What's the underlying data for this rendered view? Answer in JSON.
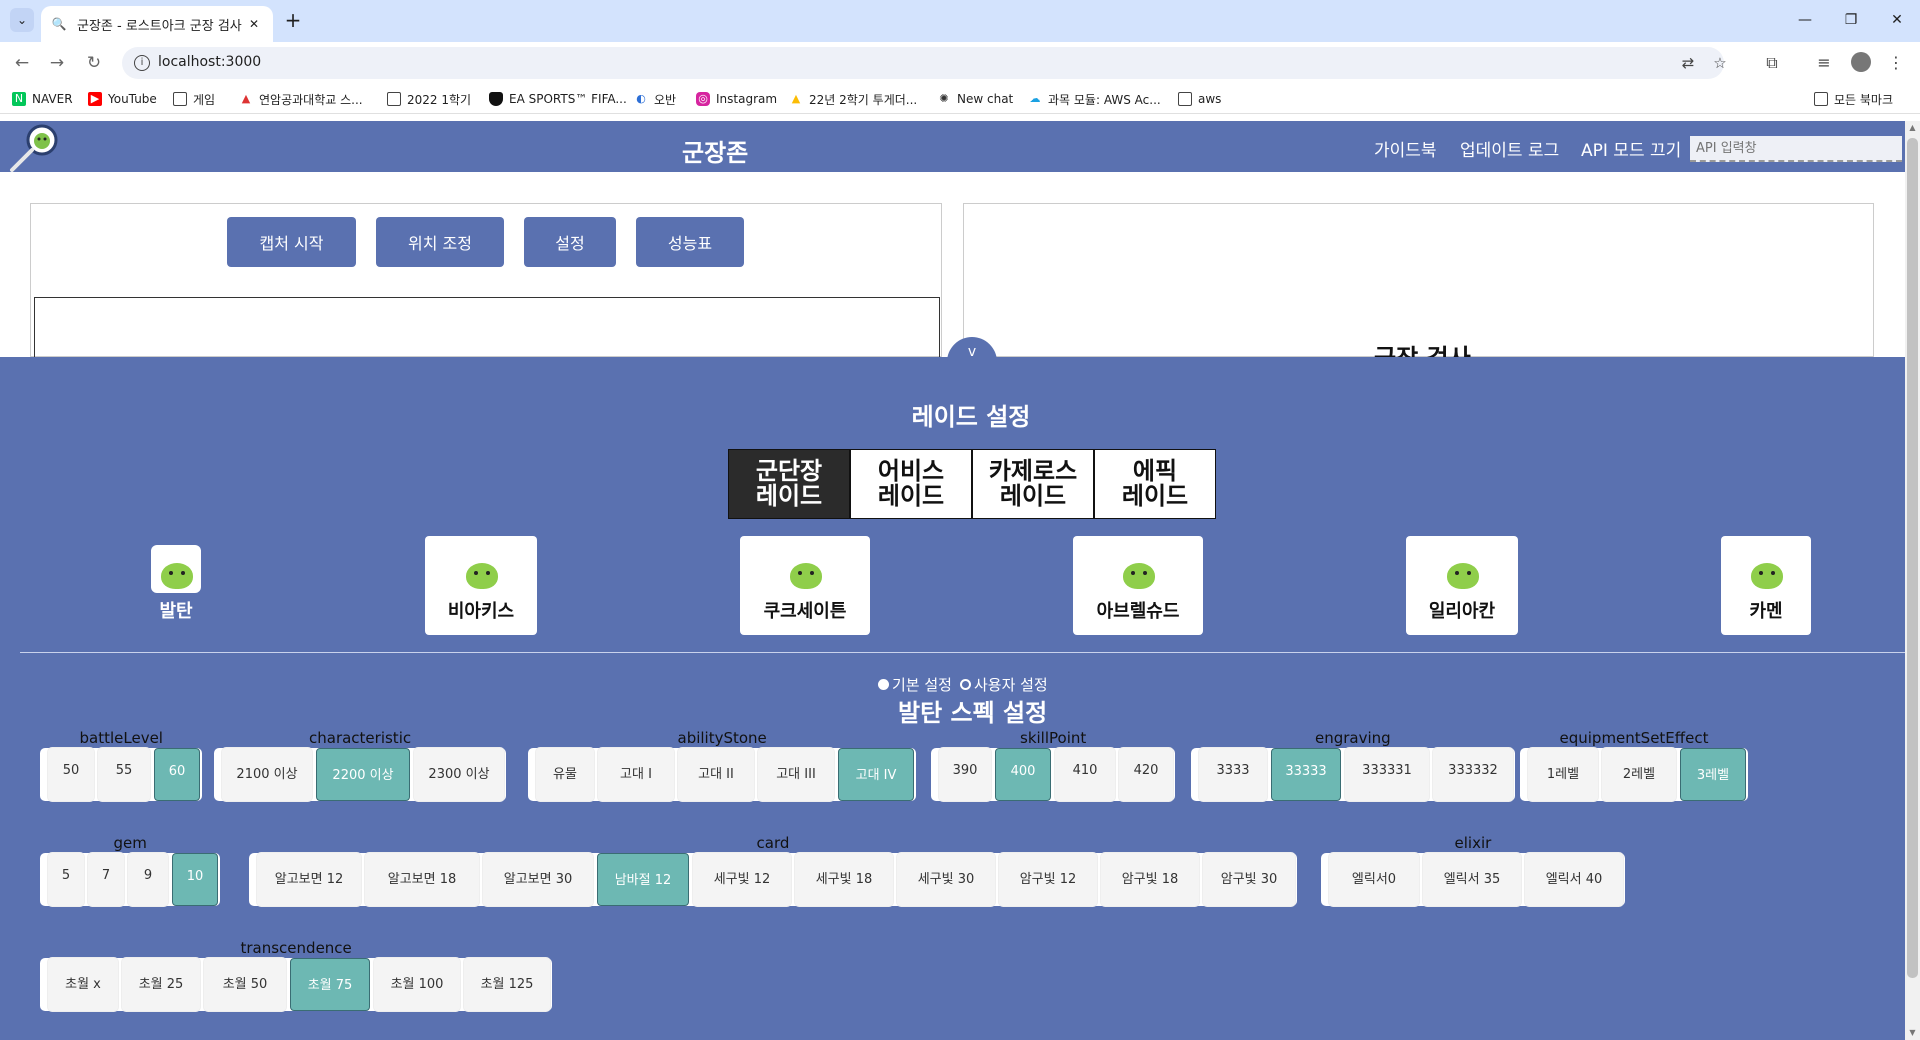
{
  "browser": {
    "tab_title": "군장존 - 로스트아크 군장 검사",
    "url": "localhost:3000",
    "bookmarks": [
      {
        "label": "NAVER",
        "icon": "naver-icon"
      },
      {
        "label": "YouTube",
        "icon": "youtube-icon"
      },
      {
        "label": "게임",
        "icon": "folder-icon"
      },
      {
        "label": "연암공과대학교 스...",
        "icon": "school-icon"
      },
      {
        "label": "2022 1학기",
        "icon": "folder-icon"
      },
      {
        "label": "EA SPORTS™ FIFA...",
        "icon": "shield-icon"
      },
      {
        "label": "오반",
        "icon": "circle-icon"
      },
      {
        "label": "Instagram",
        "icon": "instagram-icon"
      },
      {
        "label": "22년 2학기 투게더...",
        "icon": "drive-icon"
      },
      {
        "label": "New chat",
        "icon": "chat-icon"
      },
      {
        "label": "과목 모듈: AWS Ac...",
        "icon": "cloud-icon"
      },
      {
        "label": "aws",
        "icon": "folder-icon"
      }
    ],
    "all_bookmarks": "모든 북마크"
  },
  "header": {
    "title": "군장존",
    "nav": [
      "가이드북",
      "업데이트 로그",
      "API 모드 끄기"
    ],
    "api_placeholder": "API 입력창"
  },
  "controls": [
    "캡처 시작",
    "위치 조정",
    "설정",
    "성능표"
  ],
  "right_panel_title": "군장 검사",
  "drawer": {
    "toggle_icon": "v",
    "raid_title": "레이드 설정",
    "raid_tabs": [
      "군단장\n레이드",
      "어비스\n레이드",
      "카제로스\n레이드",
      "에픽\n레이드"
    ],
    "active_raid_tab": 0,
    "bosses": [
      "발탄",
      "비아키스",
      "쿠크세이튼",
      "아브렐슈드",
      "일리아칸",
      "카멘"
    ],
    "mode_default": "기본 설정",
    "mode_custom": "사용자 설정",
    "selected_mode": "기본 설정",
    "spec_title": "발탄 스펙 설정",
    "groups": [
      {
        "label": "battleLevel",
        "options": [
          "50",
          "55",
          "60"
        ],
        "selected": "60"
      },
      {
        "label": "characteristic",
        "options": [
          "2100 이상",
          "2200 이상",
          "2300 이상"
        ],
        "selected": "2200 이상"
      },
      {
        "label": "abilityStone",
        "options": [
          "유물",
          "고대 I",
          "고대 II",
          "고대 III",
          "고대 IV"
        ],
        "selected": "고대 IV"
      },
      {
        "label": "skillPoint",
        "options": [
          "390",
          "400",
          "410",
          "420"
        ],
        "selected": "400"
      },
      {
        "label": "engraving",
        "options": [
          "3333",
          "33333",
          "333331",
          "333332"
        ],
        "selected": "33333"
      },
      {
        "label": "equipmentSetEffect",
        "options": [
          "1레벨",
          "2레벨",
          "3레벨"
        ],
        "selected": "3레벨"
      },
      {
        "label": "gem",
        "options": [
          "5",
          "7",
          "9",
          "10"
        ],
        "selected": "10"
      },
      {
        "label": "card",
        "options": [
          "알고보면 12",
          "알고보면 18",
          "알고보면 30",
          "남바절 12",
          "세구빛 12",
          "세구빛 18",
          "세구빛 30",
          "암구빛 12",
          "암구빛 18",
          "암구빛 30"
        ],
        "selected": "남바절 12"
      },
      {
        "label": "elixir",
        "options": [
          "엘릭서0",
          "엘릭서 35",
          "엘릭서 40"
        ],
        "selected": ""
      },
      {
        "label": "transcendence",
        "options": [
          "초월 x",
          "초월 25",
          "초월 50",
          "초월 75",
          "초월 100",
          "초월 125"
        ],
        "selected": "초월 75"
      }
    ]
  },
  "colors": {
    "brand": "#5a71b0",
    "selected": "#6db8b3",
    "active_tab": "#2b2b2b"
  }
}
